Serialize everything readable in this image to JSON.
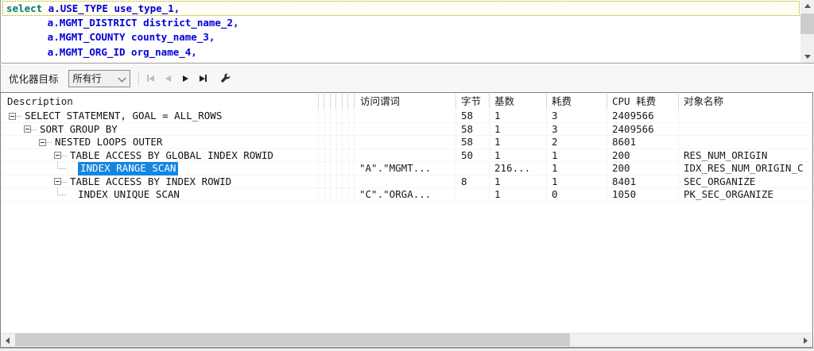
{
  "editor": {
    "lines": [
      {
        "keyword": "select",
        "code": " a.USE_TYPE use_type_1,"
      },
      {
        "keyword": "",
        "code": "       a.MGMT_DISTRICT district_name_2,"
      },
      {
        "keyword": "",
        "code": "       a.MGMT_COUNTY county_name_3,"
      },
      {
        "keyword": "",
        "code": "       a.MGMT_ORG_ID org_name_4,"
      }
    ]
  },
  "toolbar": {
    "optimizer_label": "优化器目标",
    "optimizer_value": "所有行"
  },
  "plan": {
    "header": {
      "description": "Description",
      "predicate": "访问谓词",
      "bytes": "字节",
      "cardinality": "基数",
      "cost": "耗费",
      "cpu_cost": "CPU 耗费",
      "object_name": "对象名称"
    },
    "rows": [
      {
        "level": 0,
        "type": "branch",
        "label": "SELECT STATEMENT, GOAL = ALL_ROWS",
        "predicate": "",
        "bytes": "58",
        "cardinality": "1",
        "cost": "3",
        "cpu_cost": "2409566",
        "object_name": "",
        "selected": false
      },
      {
        "level": 1,
        "type": "branch",
        "label": "SORT GROUP BY",
        "predicate": "",
        "bytes": "58",
        "cardinality": "1",
        "cost": "3",
        "cpu_cost": "2409566",
        "object_name": "",
        "selected": false
      },
      {
        "level": 2,
        "type": "branch",
        "label": "NESTED LOOPS OUTER",
        "predicate": "",
        "bytes": "58",
        "cardinality": "1",
        "cost": "2",
        "cpu_cost": "8601",
        "object_name": "",
        "selected": false
      },
      {
        "level": 3,
        "type": "branch",
        "label": "TABLE ACCESS BY GLOBAL INDEX ROWID",
        "predicate": "",
        "bytes": "50",
        "cardinality": "1",
        "cost": "1",
        "cpu_cost": "200",
        "object_name": "RES_NUM_ORIGIN",
        "selected": false
      },
      {
        "level": 4,
        "type": "leaf",
        "label": "INDEX RANGE SCAN",
        "predicate": "\"A\".\"MGMT...",
        "bytes": "",
        "cardinality": "216...",
        "cost": "1",
        "cpu_cost": "200",
        "object_name": "IDX_RES_NUM_ORIGIN_C",
        "selected": true
      },
      {
        "level": 3,
        "type": "branch",
        "label": "TABLE ACCESS BY INDEX ROWID",
        "predicate": "",
        "bytes": "8",
        "cardinality": "1",
        "cost": "1",
        "cpu_cost": "8401",
        "object_name": "SEC_ORGANIZE",
        "selected": false
      },
      {
        "level": 4,
        "type": "leaf",
        "label": "INDEX UNIQUE SCAN",
        "predicate": "\"C\".\"ORGA...",
        "bytes": "",
        "cardinality": "1",
        "cost": "0",
        "cpu_cost": "1050",
        "object_name": "PK_SEC_ORGANIZE",
        "selected": false
      }
    ]
  },
  "colors": {
    "selection": "#1586e0",
    "keyword": "#007878",
    "identifier": "#0000d8",
    "current_line_border": "#a8a400"
  }
}
